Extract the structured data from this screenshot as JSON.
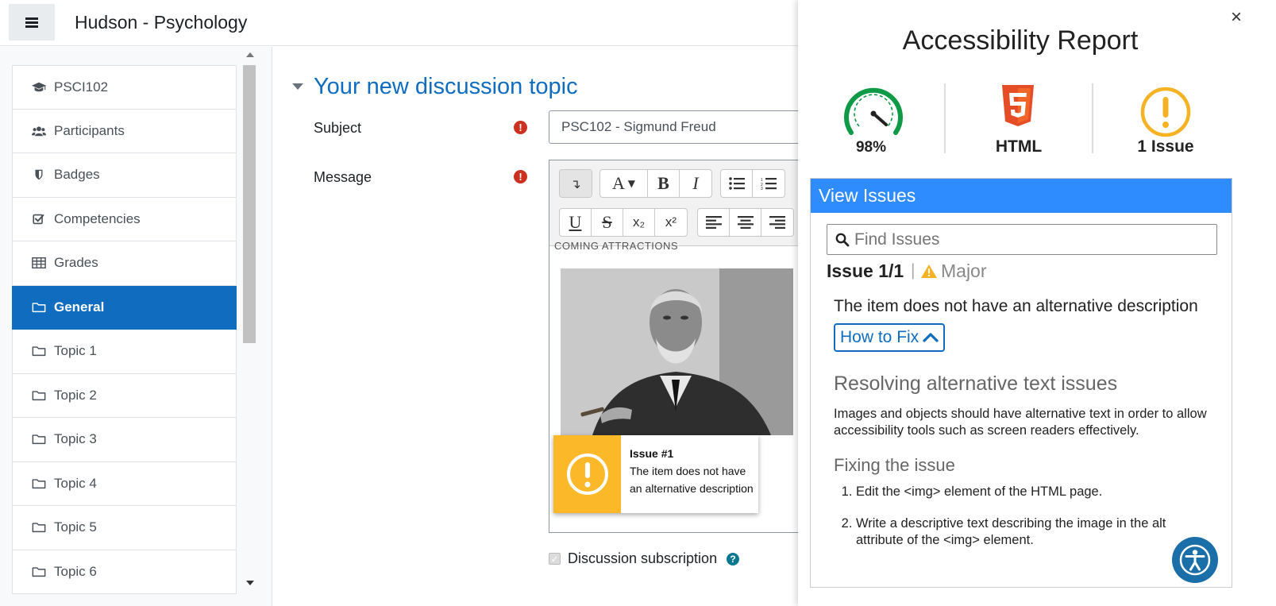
{
  "header": {
    "menu_icon": "hamburger-icon",
    "site_title": "Hudson - Psychology"
  },
  "drawer": {
    "items": [
      {
        "label": "PSCI102",
        "icon": "graduation-cap-icon",
        "active": false
      },
      {
        "label": "Participants",
        "icon": "users-icon",
        "active": false
      },
      {
        "label": "Badges",
        "icon": "shield-icon",
        "active": false
      },
      {
        "label": "Competencies",
        "icon": "check-square-icon",
        "active": false
      },
      {
        "label": "Grades",
        "icon": "table-icon",
        "active": false
      },
      {
        "label": "General",
        "icon": "folder-icon",
        "active": true
      },
      {
        "label": "Topic 1",
        "icon": "folder-icon",
        "active": false
      },
      {
        "label": "Topic 2",
        "icon": "folder-icon",
        "active": false
      },
      {
        "label": "Topic 3",
        "icon": "folder-icon",
        "active": false
      },
      {
        "label": "Topic 4",
        "icon": "folder-icon",
        "active": false
      },
      {
        "label": "Topic 5",
        "icon": "folder-icon",
        "active": false
      },
      {
        "label": "Topic 6",
        "icon": "folder-icon",
        "active": false
      }
    ]
  },
  "form": {
    "section_title": "Your new discussion topic",
    "subject_label": "Subject",
    "subject_value": "PSC102 - Sigmund Freud",
    "message_label": "Message",
    "required_glyph": "!",
    "editor_cut_text": "COMING ATTRACTIONS",
    "toolbar_row1": [
      "↴",
      "A▾",
      "B",
      "I",
      "•≡",
      "1≡"
    ],
    "toolbar_row2": [
      "U",
      "S",
      "x₂",
      "x²",
      "left-align",
      "center-align",
      "right-align"
    ],
    "issue_popup": {
      "title": "Issue #1",
      "text": "The item does not have an alternative description"
    },
    "subscription_label": "Discussion subscription",
    "subscription_checked": true,
    "help_glyph": "?"
  },
  "panel": {
    "close_glyph": "×",
    "title": "Accessibility Report",
    "metrics": {
      "score_label": "98%",
      "score_value": 98,
      "format_label": "HTML",
      "issues_label": "1 Issue"
    },
    "colors": {
      "score_green": "#0e9a47",
      "html_orange": "#e44d26",
      "warning_yellow": "#f5b323",
      "header_blue": "#2f8cfe",
      "link_blue": "#0f6cbf"
    },
    "issues": {
      "header": "View Issues",
      "search_placeholder": "Find Issues",
      "count": "Issue 1/1",
      "separator": "|",
      "severity": "Major",
      "description": "The item does not have an alternative description",
      "how_to_fix": "How to Fix",
      "resolve_title": "Resolving alternative text issues",
      "resolve_text": "Images and objects should have alternative text in order to allow accessibility tools such as screen readers effectively.",
      "fix_title": "Fixing the issue",
      "fix_steps": [
        "Edit the <img> element of the HTML page.",
        "Write a descriptive text describing the image in the alt attribute of the <img> element."
      ]
    }
  }
}
